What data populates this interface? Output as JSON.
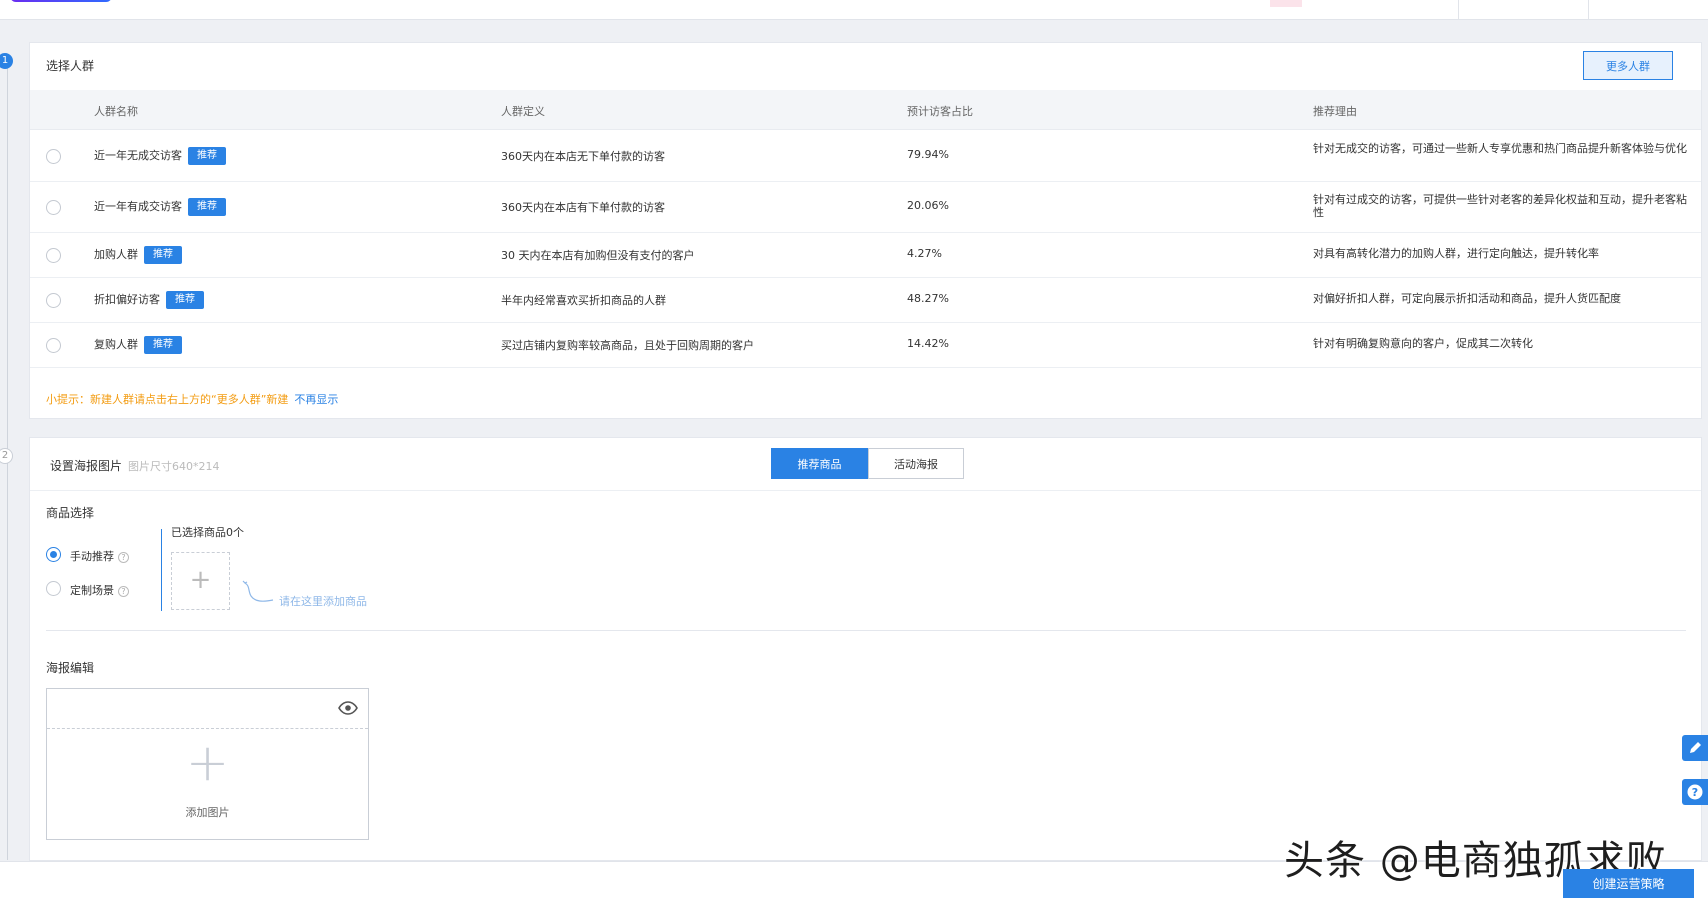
{
  "audience": {
    "title": "选择人群",
    "more_button": "更多人群",
    "columns": [
      "人群名称",
      "人群定义",
      "预计访客占比",
      "推荐理由"
    ],
    "rows": [
      {
        "name": "近一年无成交访客",
        "badge": "推荐",
        "definition": "360天内在本店无下单付款的访客",
        "ratio": "79.94%",
        "reason": "针对无成交的访客，可通过一些新人专享优惠和热门商品提升新客体验与优化"
      },
      {
        "name": "近一年有成交访客",
        "badge": "推荐",
        "definition": "360天内在本店有下单付款的访客",
        "ratio": "20.06%",
        "reason": "针对有过成交的访客，可提供一些针对老客的差异化权益和互动，提升老客粘性"
      },
      {
        "name": "加购人群",
        "badge": "推荐",
        "definition": "30 天内在本店有加购但没有支付的客户",
        "ratio": "4.27%",
        "reason": "对具有高转化潜力的加购人群，进行定向触达，提升转化率"
      },
      {
        "name": "折扣偏好访客",
        "badge": "推荐",
        "definition": "半年内经常喜欢买折扣商品的人群",
        "ratio": "48.27%",
        "reason": "对偏好折扣人群，可定向展示折扣活动和商品，提升人货匹配度"
      },
      {
        "name": "复购人群",
        "badge": "推荐",
        "definition": "买过店铺内复购率较高商品，且处于回购周期的客户",
        "ratio": "14.42%",
        "reason": "针对有明确复购意向的客户，促成其二次转化"
      }
    ],
    "tip": "小提示：新建人群请点击右上方的“更多人群”新建",
    "tip_link": "不再显示"
  },
  "steps": [
    "1",
    "2"
  ],
  "poster": {
    "title": "设置海报图片",
    "size_hint": "图片尺寸640*214",
    "tabs": [
      "推荐商品",
      "活动海报"
    ],
    "product_select_label": "商品选择",
    "options": [
      "手动推荐",
      "定制场景"
    ],
    "question_icon": "?",
    "selected_count": "已选择商品0个",
    "add_product_plus": "+",
    "add_product_hint": "请在这里添加商品",
    "edit_label": "海报编辑",
    "add_image_plus": "+",
    "add_image": "添加图片"
  },
  "footer": {
    "create_button": "创建运营策略",
    "watermark": "头条 @电商独孤求败"
  },
  "side_tools": [
    "edit-icon",
    "help-icon"
  ],
  "help_glyph": "?",
  "colors": {
    "primary": "#2a82e4",
    "tip": "#f39c12",
    "background": "#eef0f4"
  }
}
